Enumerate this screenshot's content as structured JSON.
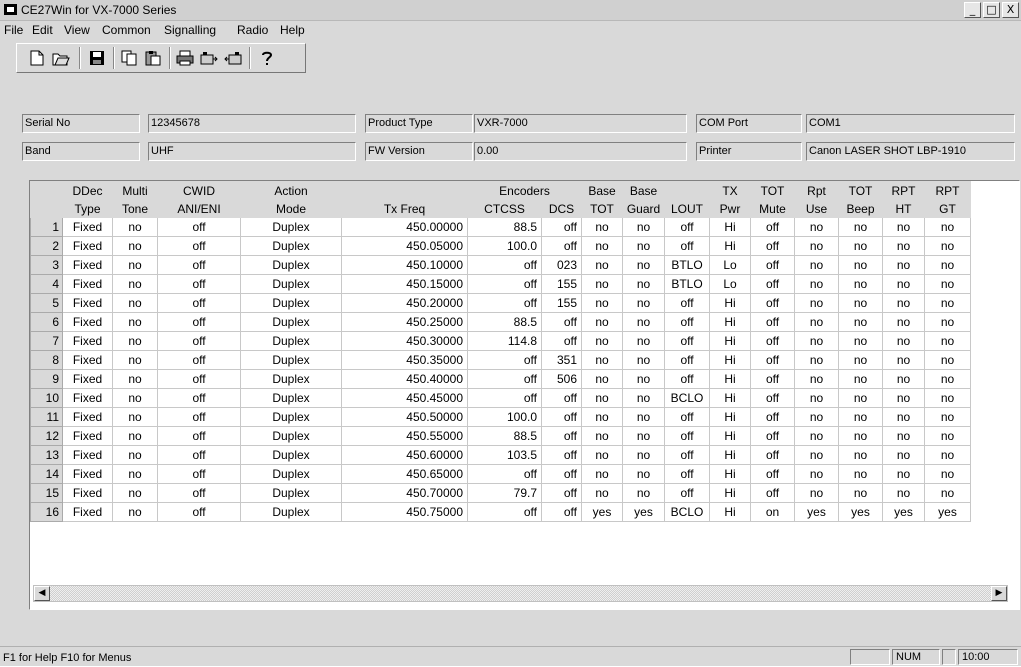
{
  "window": {
    "title": "CE27Win for VX-7000 Series",
    "controls": [
      "_",
      "□",
      "X"
    ]
  },
  "menu": [
    "File",
    "Edit",
    "View",
    "Common",
    "Signalling",
    "Radio",
    "Help"
  ],
  "toolbar_icons": [
    "new-file-icon",
    "open-folder-icon",
    "save-icon",
    "copy-icon",
    "paste-icon",
    "print-icon",
    "read-radio-icon",
    "write-radio-icon",
    "help-icon"
  ],
  "info": {
    "serial_label": "Serial No",
    "serial_value": "12345678",
    "band_label": "Band",
    "band_value": "UHF",
    "product_label": "Product Type",
    "product_value": "VXR-7000",
    "fw_label": "FW Version",
    "fw_value": "0.00",
    "com_label": "COM Port",
    "com_value": "COM1",
    "printer_label": "Printer",
    "printer_value": "Canon LASER SHOT LBP-1910"
  },
  "grid": {
    "header_top": [
      "",
      "DDec",
      "Multi",
      "CWID",
      "Action",
      "",
      "Encoders",
      "",
      "Base",
      "Base",
      "",
      "TX",
      "TOT",
      "Rpt",
      "TOT",
      "RPT",
      "RPT"
    ],
    "header_bottom": [
      "",
      "Type",
      "Tone",
      "ANI/ENI",
      "Mode",
      "Tx Freq",
      "CTCSS",
      "DCS",
      "TOT",
      "Guard",
      "LOUT",
      "Pwr",
      "Mute",
      "Use",
      "Beep",
      "HT",
      "GT"
    ],
    "rows": [
      [
        "1",
        "Fixed",
        "no",
        "off",
        "Duplex",
        "450.00000",
        "88.5",
        "off",
        "no",
        "no",
        "off",
        "Hi",
        "off",
        "no",
        "no",
        "no",
        "no"
      ],
      [
        "2",
        "Fixed",
        "no",
        "off",
        "Duplex",
        "450.05000",
        "100.0",
        "off",
        "no",
        "no",
        "off",
        "Hi",
        "off",
        "no",
        "no",
        "no",
        "no"
      ],
      [
        "3",
        "Fixed",
        "no",
        "off",
        "Duplex",
        "450.10000",
        "off",
        "023",
        "no",
        "no",
        "BTLO",
        "Lo",
        "off",
        "no",
        "no",
        "no",
        "no"
      ],
      [
        "4",
        "Fixed",
        "no",
        "off",
        "Duplex",
        "450.15000",
        "off",
        "155",
        "no",
        "no",
        "BTLO",
        "Lo",
        "off",
        "no",
        "no",
        "no",
        "no"
      ],
      [
        "5",
        "Fixed",
        "no",
        "off",
        "Duplex",
        "450.20000",
        "off",
        "155",
        "no",
        "no",
        "off",
        "Hi",
        "off",
        "no",
        "no",
        "no",
        "no"
      ],
      [
        "6",
        "Fixed",
        "no",
        "off",
        "Duplex",
        "450.25000",
        "88.5",
        "off",
        "no",
        "no",
        "off",
        "Hi",
        "off",
        "no",
        "no",
        "no",
        "no"
      ],
      [
        "7",
        "Fixed",
        "no",
        "off",
        "Duplex",
        "450.30000",
        "114.8",
        "off",
        "no",
        "no",
        "off",
        "Hi",
        "off",
        "no",
        "no",
        "no",
        "no"
      ],
      [
        "8",
        "Fixed",
        "no",
        "off",
        "Duplex",
        "450.35000",
        "off",
        "351",
        "no",
        "no",
        "off",
        "Hi",
        "off",
        "no",
        "no",
        "no",
        "no"
      ],
      [
        "9",
        "Fixed",
        "no",
        "off",
        "Duplex",
        "450.40000",
        "off",
        "506",
        "no",
        "no",
        "off",
        "Hi",
        "off",
        "no",
        "no",
        "no",
        "no"
      ],
      [
        "10",
        "Fixed",
        "no",
        "off",
        "Duplex",
        "450.45000",
        "off",
        "off",
        "no",
        "no",
        "BCLO",
        "Hi",
        "off",
        "no",
        "no",
        "no",
        "no"
      ],
      [
        "11",
        "Fixed",
        "no",
        "off",
        "Duplex",
        "450.50000",
        "100.0",
        "off",
        "no",
        "no",
        "off",
        "Hi",
        "off",
        "no",
        "no",
        "no",
        "no"
      ],
      [
        "12",
        "Fixed",
        "no",
        "off",
        "Duplex",
        "450.55000",
        "88.5",
        "off",
        "no",
        "no",
        "off",
        "Hi",
        "off",
        "no",
        "no",
        "no",
        "no"
      ],
      [
        "13",
        "Fixed",
        "no",
        "off",
        "Duplex",
        "450.60000",
        "103.5",
        "off",
        "no",
        "no",
        "off",
        "Hi",
        "off",
        "no",
        "no",
        "no",
        "no"
      ],
      [
        "14",
        "Fixed",
        "no",
        "off",
        "Duplex",
        "450.65000",
        "off",
        "off",
        "no",
        "no",
        "off",
        "Hi",
        "off",
        "no",
        "no",
        "no",
        "no"
      ],
      [
        "15",
        "Fixed",
        "no",
        "off",
        "Duplex",
        "450.70000",
        "79.7",
        "off",
        "no",
        "no",
        "off",
        "Hi",
        "off",
        "no",
        "no",
        "no",
        "no"
      ],
      [
        "16",
        "Fixed",
        "no",
        "off",
        "Duplex",
        "450.75000",
        "off",
        "off",
        "yes",
        "yes",
        "BCLO",
        "Hi",
        "on",
        "yes",
        "yes",
        "yes",
        "yes"
      ]
    ]
  },
  "status": {
    "help_text": "F1 for Help  F10 for Menus",
    "num": "NUM",
    "time": "10:00"
  }
}
